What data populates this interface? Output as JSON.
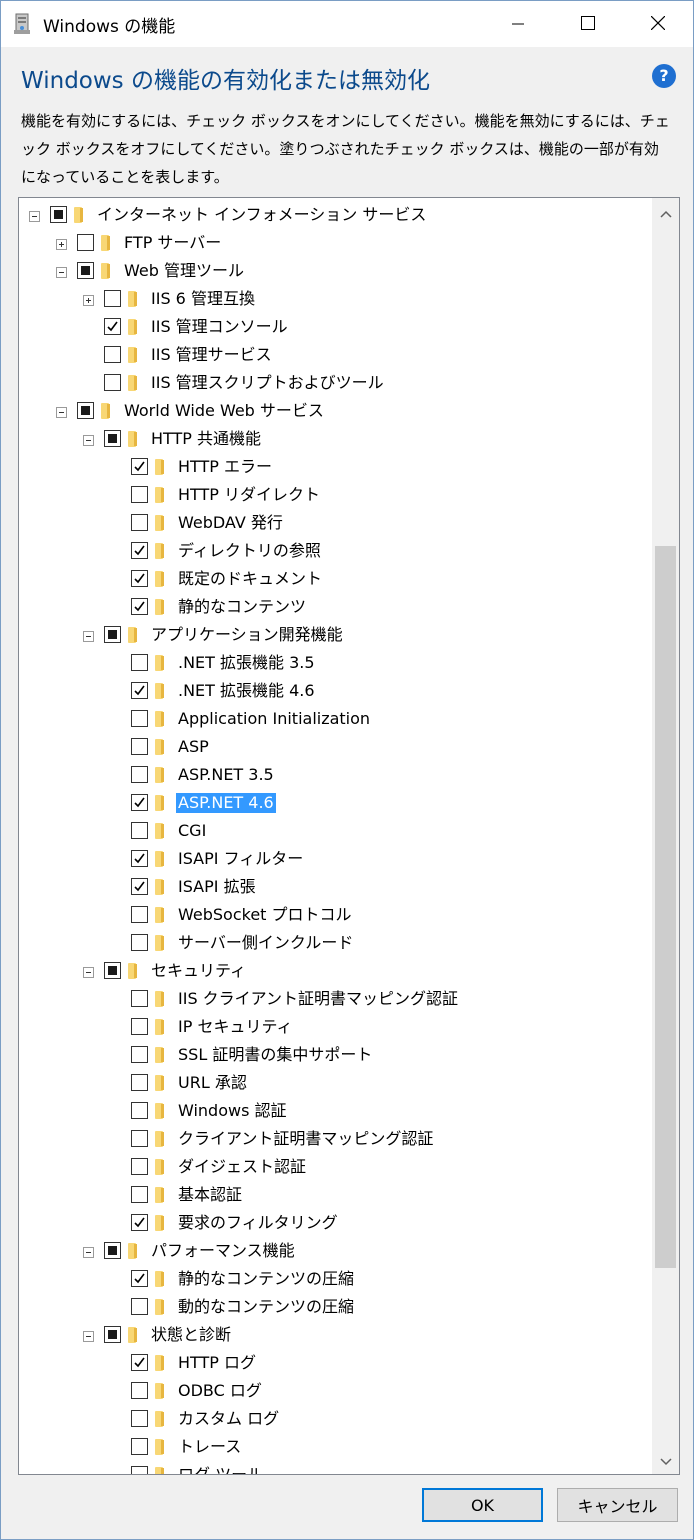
{
  "window": {
    "title": "Windows の機能",
    "heading": "Windows の機能の有効化または無効化",
    "description": "機能を有効にするには、チェック ボックスをオンにしてください。機能を無効にするには、チェック ボックスをオフにしてください。塗りつぶされたチェック ボックスは、機能の一部が有効になっていることを表します。",
    "help_icon": "?"
  },
  "buttons": {
    "ok": "OK",
    "cancel": "キャンセル"
  },
  "colors": {
    "heading": "#0c4a8c",
    "selection": "#3399ff",
    "folder": "#f8d775",
    "default_button_border": "#0078d7"
  },
  "tree": [
    {
      "label": "インターネット インフォメーション サービス",
      "level": 0,
      "expander": "minus",
      "state": "partial"
    },
    {
      "label": "FTP サーバー",
      "level": 1,
      "expander": "plus",
      "state": "unchecked"
    },
    {
      "label": "Web 管理ツール",
      "level": 1,
      "expander": "minus",
      "state": "partial"
    },
    {
      "label": "IIS 6 管理互換",
      "level": 2,
      "expander": "plus",
      "state": "unchecked"
    },
    {
      "label": "IIS 管理コンソール",
      "level": 2,
      "expander": "none",
      "state": "checked"
    },
    {
      "label": "IIS 管理サービス",
      "level": 2,
      "expander": "none",
      "state": "unchecked"
    },
    {
      "label": "IIS 管理スクリプトおよびツール",
      "level": 2,
      "expander": "none",
      "state": "unchecked"
    },
    {
      "label": "World Wide Web サービス",
      "level": 1,
      "expander": "minus",
      "state": "partial"
    },
    {
      "label": "HTTP 共通機能",
      "level": 2,
      "expander": "minus",
      "state": "partial"
    },
    {
      "label": "HTTP エラー",
      "level": 3,
      "expander": "none",
      "state": "checked"
    },
    {
      "label": "HTTP リダイレクト",
      "level": 3,
      "expander": "none",
      "state": "unchecked"
    },
    {
      "label": "WebDAV 発行",
      "level": 3,
      "expander": "none",
      "state": "unchecked"
    },
    {
      "label": "ディレクトリの参照",
      "level": 3,
      "expander": "none",
      "state": "checked"
    },
    {
      "label": "既定のドキュメント",
      "level": 3,
      "expander": "none",
      "state": "checked"
    },
    {
      "label": "静的なコンテンツ",
      "level": 3,
      "expander": "none",
      "state": "checked"
    },
    {
      "label": "アプリケーション開発機能",
      "level": 2,
      "expander": "minus",
      "state": "partial"
    },
    {
      "label": ".NET 拡張機能 3.5",
      "level": 3,
      "expander": "none",
      "state": "unchecked"
    },
    {
      "label": ".NET 拡張機能 4.6",
      "level": 3,
      "expander": "none",
      "state": "checked"
    },
    {
      "label": "Application Initialization",
      "level": 3,
      "expander": "none",
      "state": "unchecked"
    },
    {
      "label": "ASP",
      "level": 3,
      "expander": "none",
      "state": "unchecked"
    },
    {
      "label": "ASP.NET 3.5",
      "level": 3,
      "expander": "none",
      "state": "unchecked"
    },
    {
      "label": "ASP.NET 4.6",
      "level": 3,
      "expander": "none",
      "state": "checked",
      "selected": true
    },
    {
      "label": "CGI",
      "level": 3,
      "expander": "none",
      "state": "unchecked"
    },
    {
      "label": "ISAPI フィルター",
      "level": 3,
      "expander": "none",
      "state": "checked"
    },
    {
      "label": "ISAPI 拡張",
      "level": 3,
      "expander": "none",
      "state": "checked"
    },
    {
      "label": "WebSocket プロトコル",
      "level": 3,
      "expander": "none",
      "state": "unchecked"
    },
    {
      "label": "サーバー側インクルード",
      "level": 3,
      "expander": "none",
      "state": "unchecked"
    },
    {
      "label": "セキュリティ",
      "level": 2,
      "expander": "minus",
      "state": "partial"
    },
    {
      "label": "IIS クライアント証明書マッピング認証",
      "level": 3,
      "expander": "none",
      "state": "unchecked"
    },
    {
      "label": "IP セキュリティ",
      "level": 3,
      "expander": "none",
      "state": "unchecked"
    },
    {
      "label": "SSL 証明書の集中サポート",
      "level": 3,
      "expander": "none",
      "state": "unchecked"
    },
    {
      "label": "URL 承認",
      "level": 3,
      "expander": "none",
      "state": "unchecked"
    },
    {
      "label": "Windows 認証",
      "level": 3,
      "expander": "none",
      "state": "unchecked"
    },
    {
      "label": "クライアント証明書マッピング認証",
      "level": 3,
      "expander": "none",
      "state": "unchecked"
    },
    {
      "label": "ダイジェスト認証",
      "level": 3,
      "expander": "none",
      "state": "unchecked"
    },
    {
      "label": "基本認証",
      "level": 3,
      "expander": "none",
      "state": "unchecked"
    },
    {
      "label": "要求のフィルタリング",
      "level": 3,
      "expander": "none",
      "state": "checked"
    },
    {
      "label": "パフォーマンス機能",
      "level": 2,
      "expander": "minus",
      "state": "partial"
    },
    {
      "label": "静的なコンテンツの圧縮",
      "level": 3,
      "expander": "none",
      "state": "checked"
    },
    {
      "label": "動的なコンテンツの圧縮",
      "level": 3,
      "expander": "none",
      "state": "unchecked"
    },
    {
      "label": "状態と診断",
      "level": 2,
      "expander": "minus",
      "state": "partial"
    },
    {
      "label": "HTTP ログ",
      "level": 3,
      "expander": "none",
      "state": "checked"
    },
    {
      "label": "ODBC ログ",
      "level": 3,
      "expander": "none",
      "state": "unchecked"
    },
    {
      "label": "カスタム ログ",
      "level": 3,
      "expander": "none",
      "state": "unchecked"
    },
    {
      "label": "トレース",
      "level": 3,
      "expander": "none",
      "state": "unchecked"
    },
    {
      "label": "ログ ツール",
      "level": 3,
      "expander": "none",
      "state": "unchecked"
    }
  ]
}
